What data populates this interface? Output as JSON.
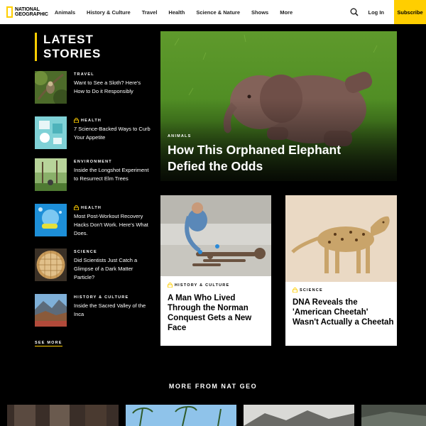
{
  "header": {
    "logo": "NATIONAL GEOGRAPHIC",
    "nav": [
      "Animals",
      "History & Culture",
      "Travel",
      "Health",
      "Science & Nature",
      "Shows",
      "More"
    ],
    "login": "Log In",
    "subscribe": "Subscribe"
  },
  "latest": {
    "heading_line1": "LATEST",
    "heading_line2": "STORIES",
    "see_more": "SEE MORE",
    "stories": [
      {
        "category": "TRAVEL",
        "title": "Want to See a Sloth? Here's How to Do it Responsibly",
        "locked": false
      },
      {
        "category": "HEALTH",
        "title": "7 Science-Backed Ways to Curb Your Appetite",
        "locked": true
      },
      {
        "category": "ENVIRONMENT",
        "title": "Inside the Longshot Experiment to Resurrect Elm Trees",
        "locked": false
      },
      {
        "category": "HEALTH",
        "title": "Most Post-Workout Recovery Hacks Don't Work. Here's What Does.",
        "locked": true
      },
      {
        "category": "SCIENCE",
        "title": "Did Scientists Just Catch a Glimpse of a Dark Matter Particle?",
        "locked": false
      },
      {
        "category": "HISTORY & CULTURE",
        "title": "Inside the Sacred Valley of the Inca",
        "locked": false
      }
    ]
  },
  "hero": {
    "category": "ANIMALS",
    "title": "How This Orphaned Elephant Defied the Odds"
  },
  "cards": [
    {
      "category": "HISTORY & CULTURE",
      "title": "A Man Who Lived Through the Norman Conquest Gets a New Face",
      "locked": true
    },
    {
      "category": "SCIENCE",
      "title": "DNA Reveals the 'American Cheetah' Wasn't Actually a Cheetah",
      "locked": true
    }
  ],
  "more": {
    "heading": "MORE FROM NAT GEO"
  },
  "colors": {
    "accent": "#ffce00",
    "background": "#000000"
  }
}
